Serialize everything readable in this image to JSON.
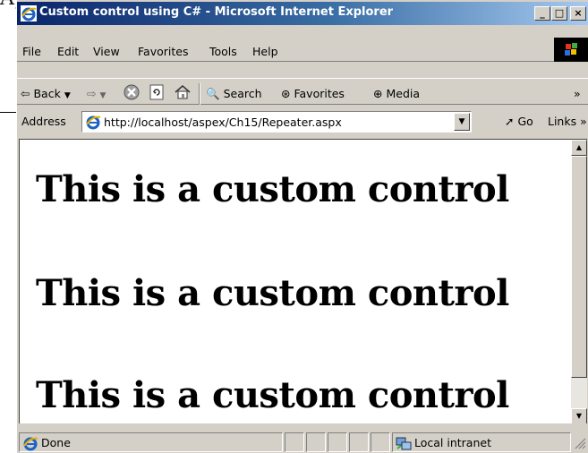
{
  "window": {
    "title": "Custom control using C# - Microsoft Internet Explorer",
    "minimize": "_",
    "maximize": "□",
    "close": "×"
  },
  "menu": [
    "File",
    "Edit",
    "View",
    "Favorites",
    "Tools",
    "Help"
  ],
  "toolbar": {
    "back": "Back",
    "search": "Search",
    "favorites": "Favorites",
    "media": "Media",
    "more": "»"
  },
  "address": {
    "label": "Address",
    "url": "http://localhost/aspex/Ch15/Repeater.aspx",
    "go": "Go",
    "links": "Links »"
  },
  "content": {
    "headings": [
      "This is a custom control",
      "This is a custom control",
      "This is a custom control"
    ]
  },
  "status": {
    "text": "Done",
    "zone": "Local intranet"
  },
  "colors": {
    "titlebar_start": "#0a246a",
    "titlebar_end": "#a6caf0",
    "chrome": "#d4d0c8"
  }
}
